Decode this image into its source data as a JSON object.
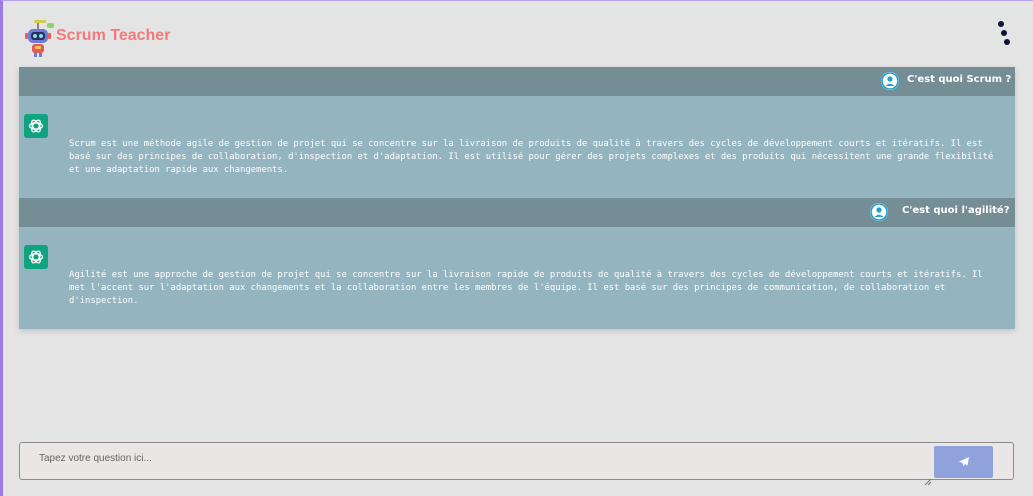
{
  "app": {
    "title": "Scrum Teacher",
    "brand_color": "#f27a7a"
  },
  "header": {
    "menu_icon": "vertical-dots-icon"
  },
  "conversation": [
    {
      "question": "C'est quoi Scrum ?",
      "answer": "Scrum est une méthode agile de gestion de projet qui se concentre sur la livraison de produits de qualité à travers des cycles de développement courts et itératifs. Il est basé sur des principes de collaboration, d'inspection et d'adaptation. Il est utilisé pour gérer des projets complexes et des produits qui nécessitent une grande flexibilité et une adaptation rapide aux changements."
    },
    {
      "question": "C'est quoi l'agilité?",
      "answer": "Agilité est une approche de gestion de projet qui se concentre sur la livraison rapide de produits de qualité à travers des cycles de développement courts et itératifs. Il met l'accent sur l'adaptation aux changements et la collaboration entre les membres de l'équipe. Il est basé sur des principes de communication, de collaboration et d'inspection."
    }
  ],
  "input": {
    "placeholder": "Tapez votre question ici...",
    "value": ""
  },
  "send_button": {
    "icon": "paper-plane-icon"
  },
  "colors": {
    "question_bar": "#758d95",
    "chat_background": "#94b4c0",
    "bot_icon": "#10a37f",
    "user_icon": "#1ea0d0",
    "send_button": "#8fa2db"
  }
}
